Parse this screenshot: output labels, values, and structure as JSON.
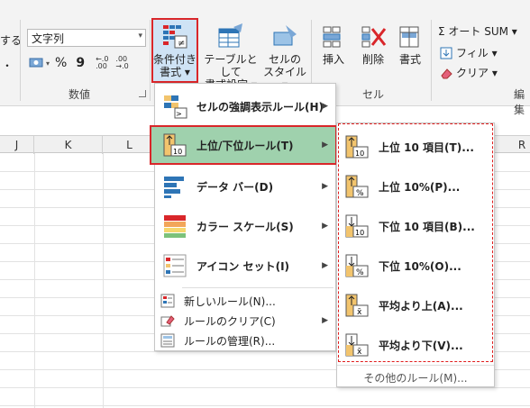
{
  "ribbon": {
    "clip_left_top": "する",
    "clip_left_mid": "・",
    "number_format_value": "文字列",
    "number_group_label": "数値",
    "pct_symbol": "%",
    "comma_symbol": "9",
    "dec_inc": "←.0\n.00",
    "dec_dec": ".00\n→.0",
    "cond_format_label_1": "条件付き",
    "cond_format_label_2": "書式 ▾",
    "table_format_label_1": "テーブルとして",
    "table_format_label_2": "書式設定 ▾",
    "cell_style_label_1": "セルの",
    "cell_style_label_2": "スタイル ▾",
    "insert_label": "挿入",
    "delete_label": "削除",
    "format_label": "書式",
    "cells_group_label": "セル",
    "autosum_label": "Σ オート SUM ▾",
    "fill_label": "フィル ▾",
    "clear_label": "クリア ▾",
    "edit_group_label": "編集"
  },
  "sheet": {
    "columns": [
      "J",
      "K",
      "L",
      "R"
    ]
  },
  "menu1": {
    "items": [
      {
        "label": "セルの強調表示ルール(H)",
        "submenu": "▶"
      },
      {
        "label": "上位/下位ルール(T)",
        "submenu": "▶"
      },
      {
        "label": "データ バー(D)",
        "submenu": "▶"
      },
      {
        "label": "カラー スケール(S)",
        "submenu": "▶"
      },
      {
        "label": "アイコン セット(I)",
        "submenu": "▶"
      }
    ],
    "small_items": [
      {
        "label": "新しいルール(N)..."
      },
      {
        "label": "ルールのクリア(C)",
        "submenu": "▶"
      },
      {
        "label": "ルールの管理(R)..."
      }
    ]
  },
  "menu2": {
    "items": [
      {
        "label": "上位 10 項目(T)...",
        "icon_text": "10"
      },
      {
        "label": "上位 10%(P)...",
        "icon_text": "%"
      },
      {
        "label": "下位 10 項目(B)...",
        "icon_text": "10"
      },
      {
        "label": "下位 10%(O)...",
        "icon_text": "%"
      },
      {
        "label": "平均より上(A)...",
        "icon_text": "x̄"
      },
      {
        "label": "平均より下(V)...",
        "icon_text": "x̄"
      }
    ],
    "footer": "その他のルール(M)..."
  },
  "colors": {
    "highlight": "#9fd1ad",
    "red_border": "#d9262a",
    "accent_blue": "#2e75b6"
  }
}
